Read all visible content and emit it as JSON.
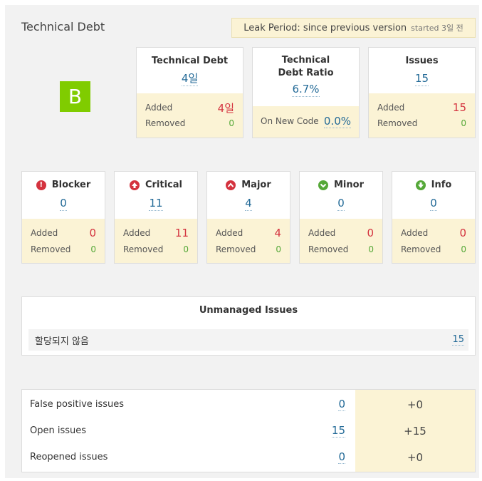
{
  "header": {
    "title": "Technical Debt",
    "leak_period": "Leak Period: since previous version",
    "leak_started": "started 3일 전"
  },
  "rating": "B",
  "colors": {
    "rating_bg": "#80cc00",
    "leak_bg": "#fbf3d5",
    "link_blue": "#236a97",
    "added_red": "#d4333f",
    "removed_green": "#55a838",
    "blocker": "#d4333f",
    "critical": "#d4333f",
    "major": "#d4333f",
    "minor": "#55a838",
    "info": "#55a838"
  },
  "debt_cards": [
    {
      "title": "Technical Debt",
      "value": "4일",
      "added_label": "Added",
      "added": "4일",
      "removed_label": "Removed",
      "removed": "0"
    },
    {
      "title": "Technical Debt Ratio",
      "value": "6.7%",
      "new_code_label": "On New Code",
      "new_code": "0.0%"
    },
    {
      "title": "Issues",
      "value": "15",
      "added_label": "Added",
      "added": "15",
      "removed_label": "Removed",
      "removed": "0"
    }
  ],
  "severities": [
    {
      "title": "Blocker",
      "icon": "blocker-icon",
      "value": "0",
      "added_label": "Added",
      "added": "0",
      "removed_label": "Removed",
      "removed": "0"
    },
    {
      "title": "Critical",
      "icon": "critical-icon",
      "value": "11",
      "added_label": "Added",
      "added": "11",
      "removed_label": "Removed",
      "removed": "0"
    },
    {
      "title": "Major",
      "icon": "major-icon",
      "value": "4",
      "added_label": "Added",
      "added": "4",
      "removed_label": "Removed",
      "removed": "0"
    },
    {
      "title": "Minor",
      "icon": "minor-icon",
      "value": "0",
      "added_label": "Added",
      "added": "0",
      "removed_label": "Removed",
      "removed": "0"
    },
    {
      "title": "Info",
      "icon": "info-icon",
      "value": "0",
      "added_label": "Added",
      "added": "0",
      "removed_label": "Removed",
      "removed": "0"
    }
  ],
  "unmanaged": {
    "title": "Unmanaged Issues",
    "rows": [
      {
        "label": "할당되지 않음",
        "value": "15"
      }
    ]
  },
  "issue_status": [
    {
      "label": "False positive issues",
      "value": "0",
      "delta": "+0"
    },
    {
      "label": "Open issues",
      "value": "15",
      "delta": "+15"
    },
    {
      "label": "Reopened issues",
      "value": "0",
      "delta": "+0"
    }
  ]
}
